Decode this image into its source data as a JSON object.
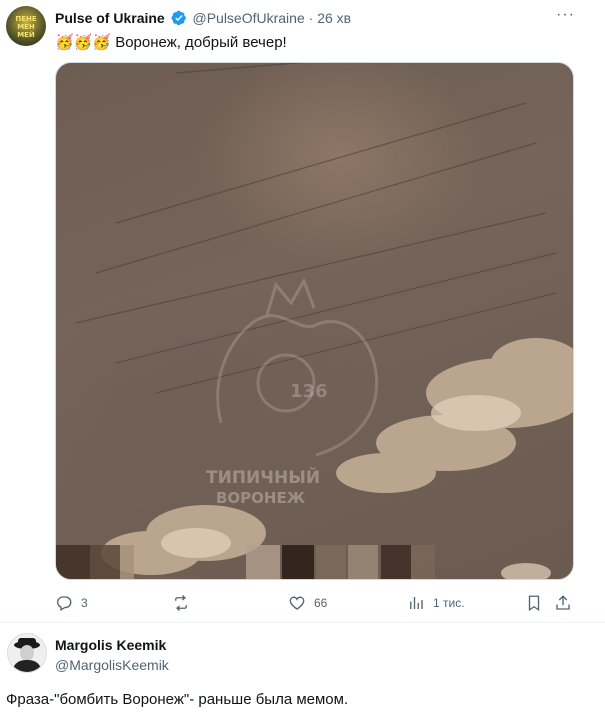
{
  "tweet": {
    "author_name": "Pulse of Ukraine",
    "handle": "@PulseOfUkraine",
    "separator": "·",
    "time": "26 хв",
    "emojis": "🥳🥳🥳",
    "text": "Воронеж, добрый вечер!",
    "avatar_text": "ПЕНЕ МЕН МЕЙ"
  },
  "media": {
    "watermark_number": "136",
    "watermark_line1": "ТИПИЧНЫЙ",
    "watermark_line2": "ВОРОНЕЖ"
  },
  "actions": {
    "replies": "3",
    "reposts": "",
    "likes": "66",
    "views": "1 тис."
  },
  "reply": {
    "author_name": "Margolis Keemik",
    "handle": "@MargolisKeemik",
    "text": "Фраза-\"бомбить Воронеж\"- раньше была мемом."
  },
  "colors": {
    "verified": "#1d9bf0",
    "secondary_text": "#536471"
  }
}
